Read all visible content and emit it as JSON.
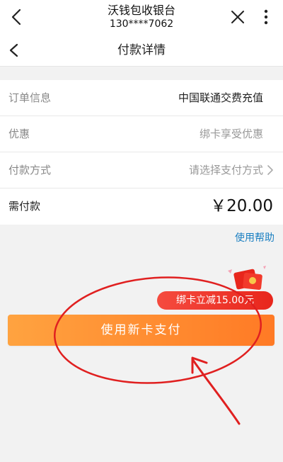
{
  "header": {
    "title": "沃钱包收银台",
    "subtitle": "130****7062"
  },
  "subheader": {
    "title": "付款详情"
  },
  "order": {
    "rows": [
      {
        "label": "订单信息",
        "value": "中国联通交费充值"
      },
      {
        "label": "优惠",
        "value": "绑卡享受优惠"
      },
      {
        "label": "付款方式",
        "value": "请选择支付方式"
      },
      {
        "label": "需付款",
        "value": "￥20.00"
      }
    ]
  },
  "help_link": "使用帮助",
  "promo_badge": "绑卡立减15.00元",
  "pay_button": "使用新卡支付",
  "colors": {
    "accent": "#ff8a2b",
    "badge": "#e8261c",
    "link": "#1a7fc1",
    "annotation": "#e02020"
  },
  "icons": {
    "back": "chevron-left-icon",
    "close": "close-icon",
    "more": "more-vertical-icon",
    "chevron": "chevron-right-icon",
    "red_packet": "red-packet-icon"
  }
}
